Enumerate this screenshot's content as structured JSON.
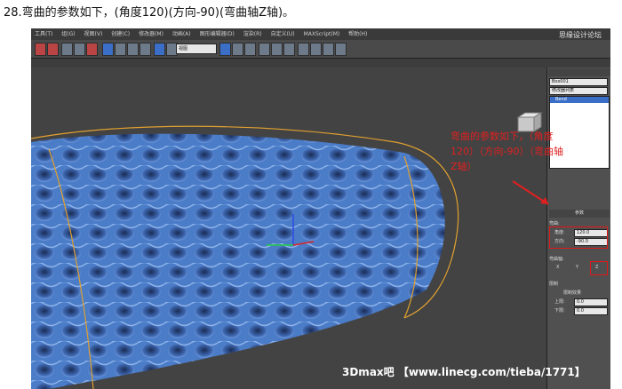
{
  "caption": "28.弯曲的参数如下，(角度120)(方向-90)(弯曲轴Z轴)。",
  "menu": {
    "items": [
      "工具(T)",
      "组(G)",
      "视图(V)",
      "创建(C)",
      "修改器(M)",
      "动画(A)",
      "图形编辑器(D)",
      "渲染(R)",
      "自定义(U)",
      "MAXScript(M)",
      "帮助(H)"
    ]
  },
  "watermark": "思缘设计论坛",
  "toolbar": {
    "dropdown_value": "视图"
  },
  "panel": {
    "object_name": "Box001",
    "modifier_list": "修改器列表",
    "stack_item": "Bend",
    "params_title": "参数",
    "bend_label": "弯曲:",
    "angle_label": "角度:",
    "angle_value": "120.0",
    "direction_label": "方向:",
    "direction_value": "-90.0",
    "axis_label": "弯曲轴:",
    "axis_x": "X",
    "axis_y": "Y",
    "axis_z": "Z",
    "limit_label": "限制",
    "limit_check_label": "限制效果",
    "upper_label": "上限:",
    "upper_value": "0.0",
    "lower_label": "下限:",
    "lower_value": "0.0"
  },
  "annotation": "弯曲的参数如下，（角度120）（方向-90）（弯曲轴Z轴）",
  "footer": "3Dmax吧 【www.linecg.com/tieba/1771】",
  "colors": {
    "annotation": "#e02020",
    "mesh": "#4a7cc8",
    "gizmo": "#e0a030"
  }
}
